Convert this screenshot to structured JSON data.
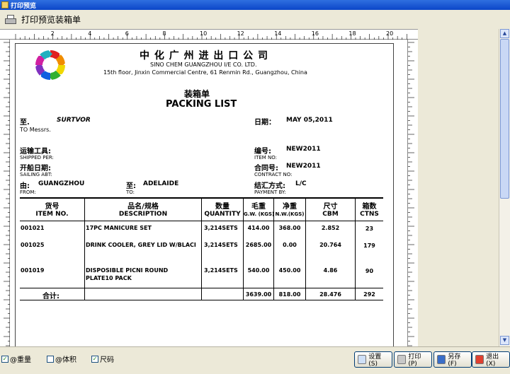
{
  "window": {
    "title": "打印预览"
  },
  "toolbar": {
    "label": "打印预览装箱单"
  },
  "company": {
    "name_cn": "中 化 广 州 进 出 口 公 司",
    "name_en": "SINO CHEM GUANGZHOU I/E CO. LTD.",
    "address": "15th floor, Jinxin Commercial Centre, 61 Renmin Rd., Guangzhou, China"
  },
  "doc": {
    "title_cn": "装箱单",
    "title_en": "PACKING LIST"
  },
  "fields": {
    "to_cn": "至.",
    "to_value": "SURTVOR",
    "to_en": "TO Messrs.",
    "date_cn": "日期：",
    "date_value": "MAY 05,2011",
    "shipped_cn": "运输工具:",
    "shipped_en": "SHIPPED PER:",
    "no_cn": "编号:",
    "no_value": "NEW2011",
    "no_en": "ITEM NO:",
    "sailing_cn": "开船日期:",
    "sailing_en": "SAILING ABT:",
    "contract_cn": "合同号:",
    "contract_value": "NEW2011",
    "contract_en": "CONTRACT NO:",
    "from_cn": "由:",
    "from_value": "GUANGZHOU",
    "from_en": "FROM:",
    "dest_cn": "至:",
    "dest_value": "ADELAIDE",
    "dest_en": "TO:",
    "payment_cn": "结汇方式:",
    "payment_value": "L/C",
    "payment_en": "PAYMENT BY:"
  },
  "table": {
    "headers": [
      {
        "cn": "货号",
        "en": "ITEM NO."
      },
      {
        "cn": "品名/规格",
        "en": "DESCRIPTION"
      },
      {
        "cn": "数量",
        "en": "QUANTITY"
      },
      {
        "cn": "毛重",
        "en": "G.W. (KGS)"
      },
      {
        "cn": "净重",
        "en": "N.W.(KGS)"
      },
      {
        "cn": "尺寸",
        "en": "CBM"
      },
      {
        "cn": "箱数",
        "en": "CTNS"
      }
    ],
    "rows": [
      {
        "item": "001021",
        "desc1": "17PC MANICURE SET",
        "desc2": "",
        "qty": "3,214SETS",
        "gw": "414.00",
        "nw": "368.00",
        "cbm": "2.852",
        "ctns": "23"
      },
      {
        "item": "001025",
        "desc1": "DRINK COOLER, GREY LID W/BLACI",
        "desc2": "",
        "qty": "3,214SETS",
        "gw": "2685.00",
        "nw": "0.00",
        "cbm": "20.764",
        "ctns": "179"
      },
      {
        "item": "001019",
        "desc1": "DISPOSIBLE PICNI ROUND",
        "desc2": "PLATE10 PACK",
        "qty": "3,214SETS",
        "gw": "540.00",
        "nw": "450.00",
        "cbm": "4.86",
        "ctns": "90"
      }
    ],
    "total": {
      "label": "合计:",
      "gw": "3639.00",
      "nw": "818.00",
      "cbm": "28.476",
      "ctns": "292"
    }
  },
  "status": {
    "checks": [
      {
        "label": "@重量",
        "checked": true
      },
      {
        "label": "@体积",
        "checked": false
      },
      {
        "label": "尺码",
        "checked": true
      }
    ],
    "buttons": {
      "settings": "设置(S)",
      "print": "打印(P)",
      "save_as": "另存(F)",
      "exit": "退出(X)"
    }
  },
  "ruler": {
    "ticks": [
      "2",
      "4",
      "6",
      "8",
      "10",
      "12",
      "14",
      "16",
      "18",
      "20"
    ]
  },
  "colors": {
    "titlebar": "#0b46c8",
    "logo": [
      "#e02020",
      "#f08c00",
      "#f0d800",
      "#30b030",
      "#1060e0",
      "#8030c0",
      "#d020a0",
      "#20b0c0"
    ]
  }
}
